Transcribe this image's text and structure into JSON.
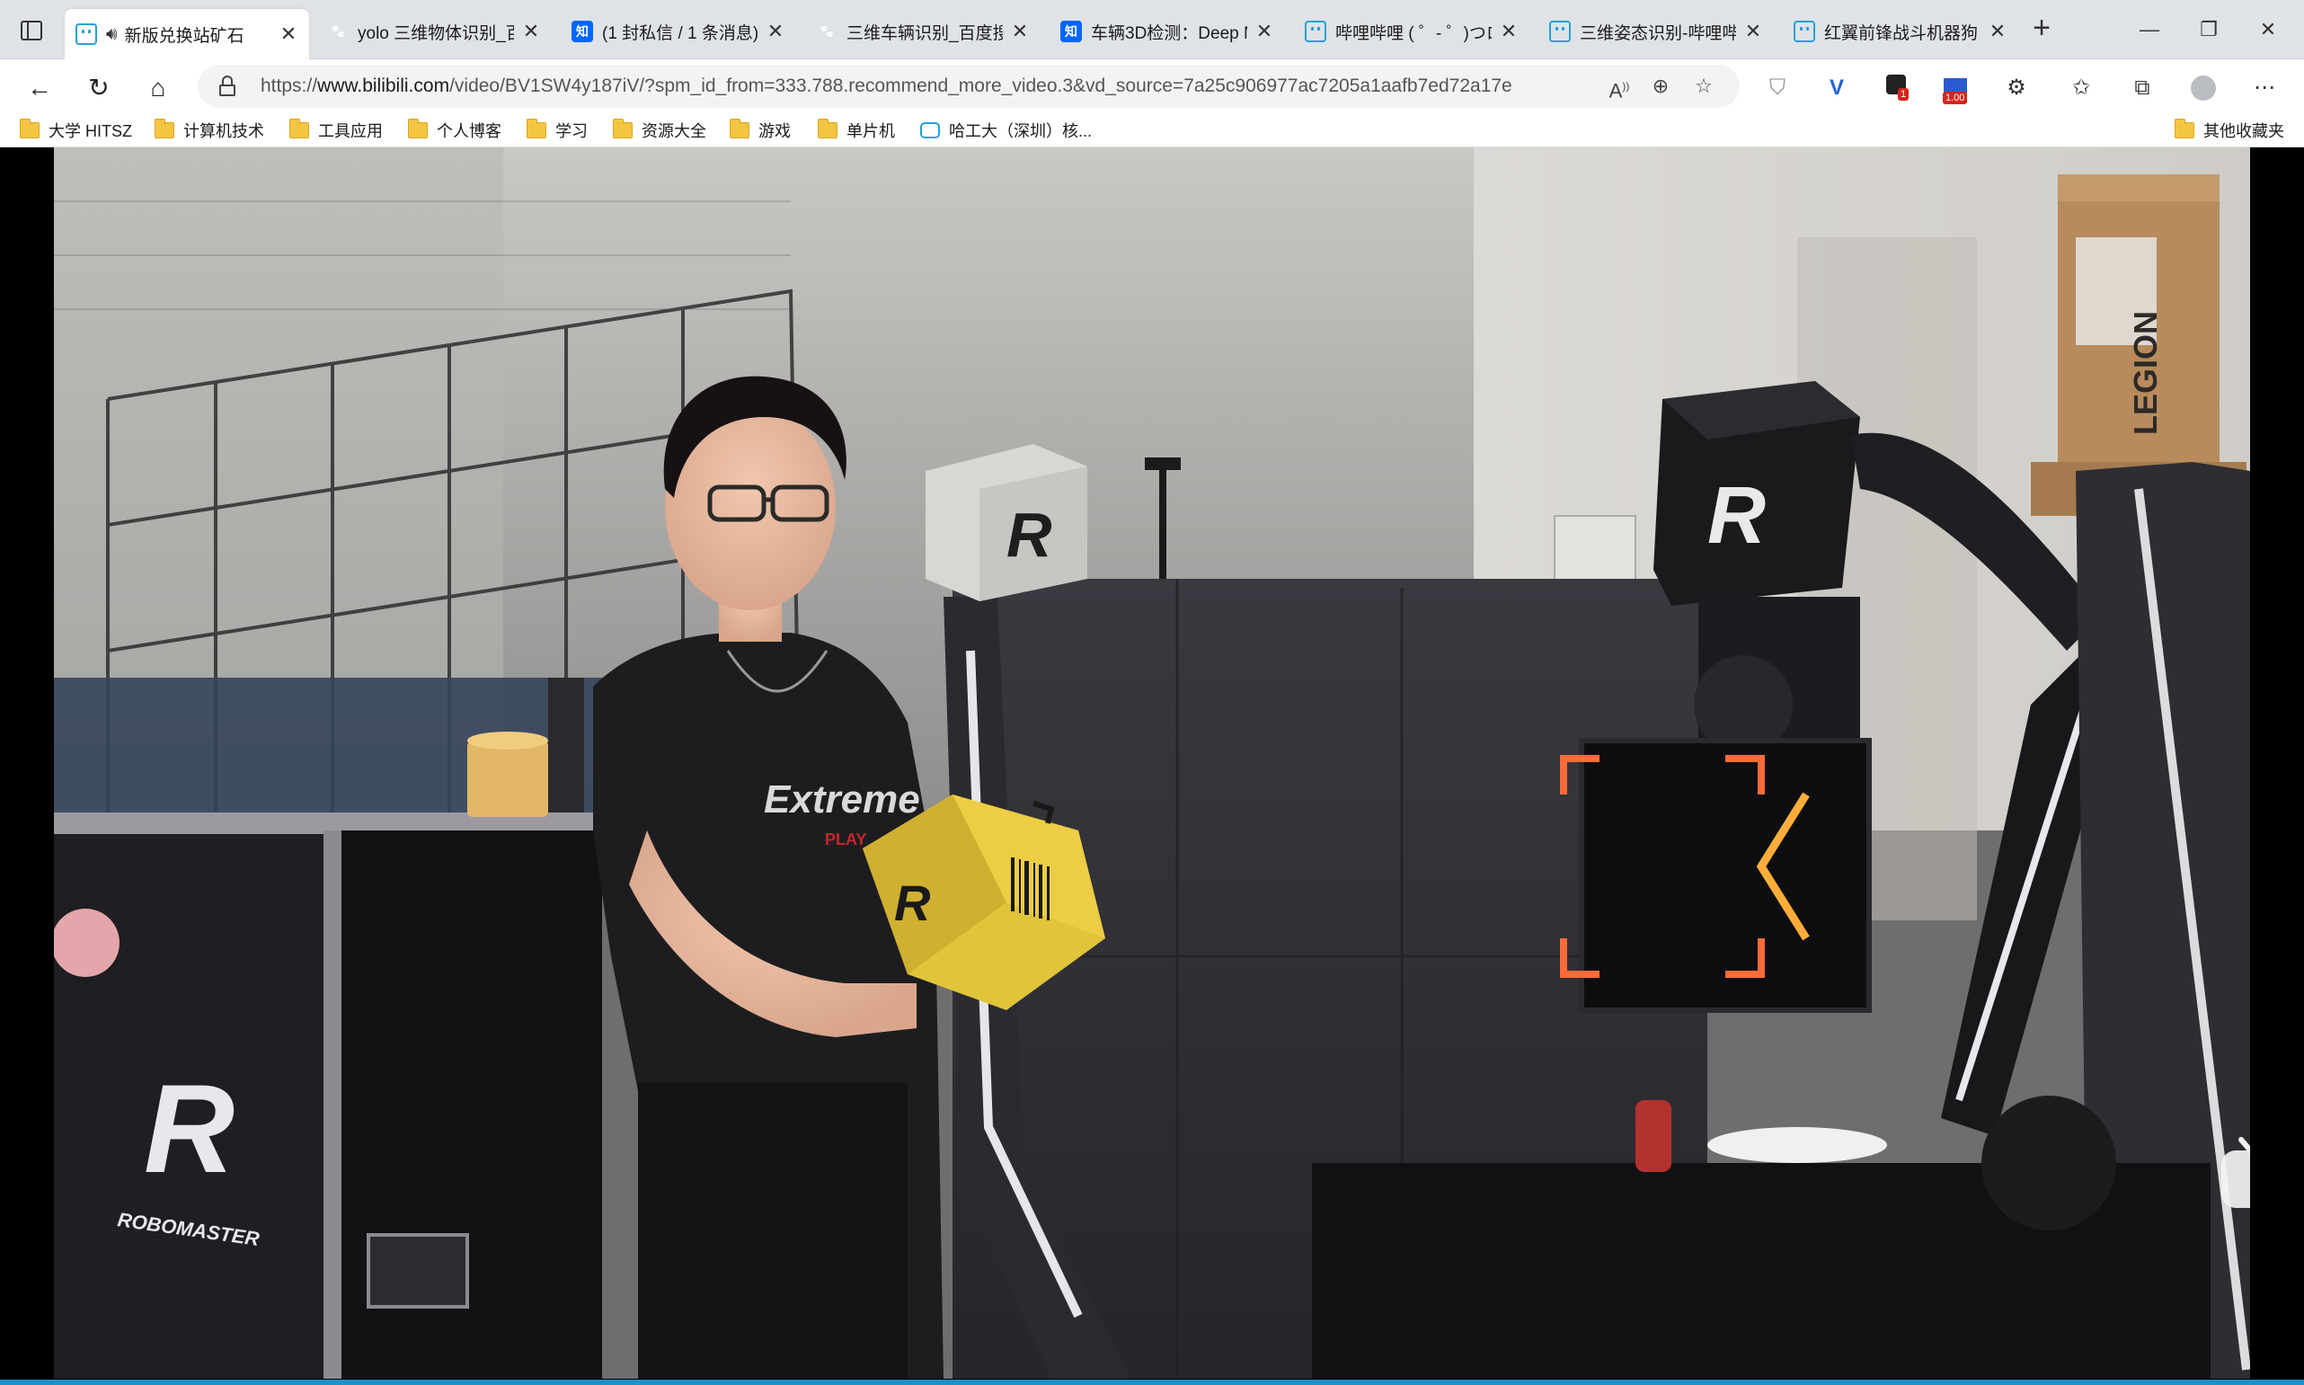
{
  "tabs": [
    {
      "title": "新版兑换站矿石",
      "favicon": "bilibili-icon",
      "audio": true,
      "active": true
    },
    {
      "title": "yolo 三维物体识别_百",
      "favicon": "baidu-icon",
      "active": false
    },
    {
      "title": "(1 封私信 / 1 条消息)",
      "favicon": "zhihu-icon",
      "active": false
    },
    {
      "title": "三维车辆识别_百度搜",
      "favicon": "baidu-icon",
      "active": false
    },
    {
      "title": "车辆3D检测：Deep M",
      "favicon": "zhihu-icon",
      "active": false
    },
    {
      "title": "哔哩哔哩 ( ゜- ゜)つロ",
      "favicon": "bilibili-icon",
      "active": false
    },
    {
      "title": "三维姿态识别-哔哩哔",
      "favicon": "bilibili-icon",
      "active": false
    },
    {
      "title": "红翼前锋战斗机器狗",
      "favicon": "bilibili-icon",
      "active": false
    }
  ],
  "zhihu_glyph": "知",
  "address": {
    "scheme": "https://",
    "host": "www.bilibili.com",
    "path": "/video/BV1SW4y187iV/?spm_id_from=333.788.recommend_more_video.3&vd_source=7a25c906977ac7205a1aafb7ed72a17e"
  },
  "badges": {
    "ext_red": "1",
    "ext_speed": "1.00"
  },
  "favorites": [
    {
      "label": "大学 HITSZ",
      "icon": "folder-icon"
    },
    {
      "label": "计算机技术",
      "icon": "folder-icon"
    },
    {
      "label": "工具应用",
      "icon": "folder-icon"
    },
    {
      "label": "个人博客",
      "icon": "folder-icon"
    },
    {
      "label": "学习",
      "icon": "folder-icon"
    },
    {
      "label": "资源大全",
      "icon": "folder-icon"
    },
    {
      "label": "游戏",
      "icon": "folder-icon"
    },
    {
      "label": "单片机",
      "icon": "folder-icon"
    },
    {
      "label": "哈工大（深圳）核...",
      "icon": "bilibili-icon"
    }
  ],
  "other_favorites": "其他收藏夹",
  "video": {
    "shirt_text": "Extreme",
    "shirt_subtext": "PLAY",
    "cube_logo": "R",
    "robot_logo": "R",
    "case_brand": "ROBOMASTER",
    "box_brand": "LEGION"
  }
}
